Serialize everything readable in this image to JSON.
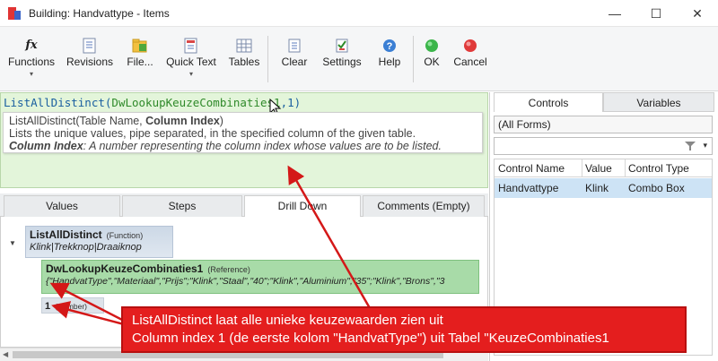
{
  "window": {
    "title": "Building: Handvattype - Items",
    "minimize": "—",
    "maximize": "☐",
    "close": "✕"
  },
  "ribbon": {
    "buttons": [
      {
        "label": "Functions",
        "icon": "fx-icon",
        "dropdown": "▾"
      },
      {
        "label": "Revisions",
        "icon": "revisions-icon"
      },
      {
        "label": "File...",
        "icon": "file-icon"
      },
      {
        "label": "Quick Text",
        "icon": "quick-text-icon",
        "dropdown": "▾"
      },
      {
        "label": "Tables",
        "icon": "tables-icon"
      },
      {
        "label": "Clear",
        "icon": "clear-icon"
      },
      {
        "label": "Settings",
        "icon": "settings-icon"
      },
      {
        "label": "Help",
        "icon": "help-icon"
      },
      {
        "label": "OK",
        "icon": "ok-icon"
      },
      {
        "label": "Cancel",
        "icon": "cancel-icon"
      }
    ],
    "fx_glyph": "fx"
  },
  "expression": {
    "func": "ListAllDistinct(",
    "arg": "DwLookupKeuzeCombinaties1",
    "rest": ",1)"
  },
  "tooltip": {
    "sig_func": "ListAllDistinct(Table Name, ",
    "sig_bold": "Column Index",
    "sig_end": ")",
    "desc": "Lists the unique values, pipe separated, in the specified column of the given table.",
    "param_name": "Column Index",
    "param_desc": ": A number representing the column index whose values are to be listed."
  },
  "tabs": [
    {
      "label": "Values"
    },
    {
      "label": "Steps"
    },
    {
      "label": "Drill Down"
    },
    {
      "label": "Comments (Empty)"
    }
  ],
  "drill": {
    "expander": "▼",
    "node1": {
      "title": "ListAllDistinct",
      "type": "(Function)",
      "value": "Klink|Trekknop|Draaiknop"
    },
    "node2": {
      "title": "DwLookupKeuzeCombinaties1",
      "type": "(Reference)",
      "value": "{\"HandvatType\",\"Materiaal\",\"Prijs\";\"Klink\",\"Staal\",\"40\";\"Klink\",\"Aluminium\",\"35\";\"Klink\",\"Brons\",\"3"
    },
    "node3": {
      "num": "1",
      "type": "(Number)"
    },
    "scroll_left": "◀"
  },
  "right": {
    "tabs": [
      {
        "label": "Controls"
      },
      {
        "label": "Variables"
      }
    ],
    "forms_select": "(All Forms)",
    "filter_dd": "▾",
    "columns": [
      "Control Name",
      "Value",
      "Control Type"
    ],
    "rows": [
      {
        "name": "Handvattype",
        "value": "Klink",
        "type": "Combo Box"
      }
    ]
  },
  "annotation": {
    "line1": "ListAllDistinct laat alle unieke keuzewaarden zien uit",
    "line2": "Column index 1 (de eerste kolom \"HandvatType\") uit Tabel \"KeuzeCombinaties1"
  },
  "colors": {
    "accent_red": "#e41e1e",
    "ref_green": "#a8dba8",
    "expr_bg": "#e3f5da"
  }
}
